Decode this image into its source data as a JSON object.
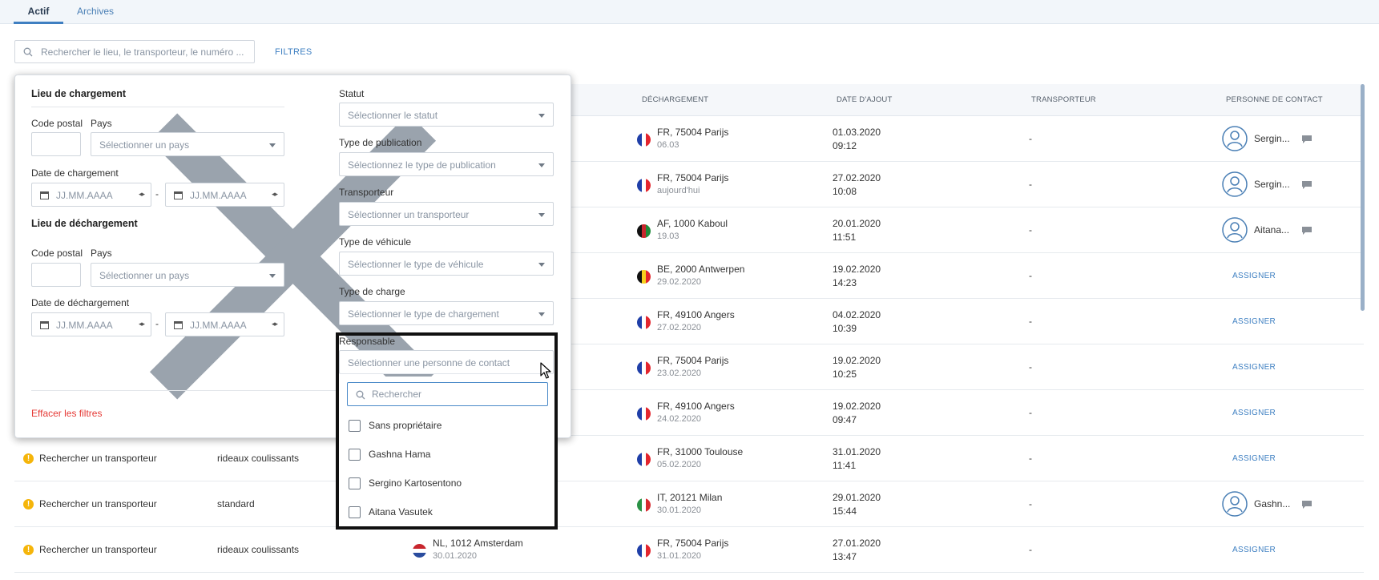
{
  "tabs": {
    "active": "Actif",
    "archives": "Archives"
  },
  "search": {
    "placeholder": "Rechercher le lieu, le transporteur, le numéro ..."
  },
  "filtres_label": "FILTRES",
  "table": {
    "headers": {
      "dechargement": "DÉCHARGEMENT",
      "date_ajout": "DATE D'AJOUT",
      "transporteur": "TRANSPORTEUR",
      "contact": "PERSONNE DE CONTACT"
    },
    "rows": [
      {
        "dest_flag": "FR",
        "dest": "FR, 75004 Parijs",
        "dest_date": "06.03",
        "date": "01.03.2020",
        "time": "09:12",
        "transporteur": "-",
        "contact": "Sergin...",
        "chat": true
      },
      {
        "dest_flag": "FR",
        "dest": "FR, 75004 Parijs",
        "dest_date": "aujourd'hui",
        "date": "27.02.2020",
        "time": "10:08",
        "transporteur": "-",
        "contact": "Sergin...",
        "chat": true
      },
      {
        "dest_flag": "AF",
        "dest": "AF, 1000 Kaboul",
        "dest_date": "19.03",
        "date": "20.01.2020",
        "time": "11:51",
        "transporteur": "-",
        "contact": "Aitana...",
        "chat": true
      },
      {
        "dest_flag": "BE",
        "dest": "BE, 2000 Antwerpen",
        "dest_date": "29.02.2020",
        "date": "19.02.2020",
        "time": "14:23",
        "transporteur": "-",
        "assign": "ASSIGNER"
      },
      {
        "dest_flag": "FR",
        "dest": "FR, 49100 Angers",
        "dest_date": "27.02.2020",
        "date": "04.02.2020",
        "time": "10:39",
        "transporteur": "-",
        "assign": "ASSIGNER"
      },
      {
        "dest_flag": "FR",
        "dest": "FR, 75004 Parijs",
        "dest_date": "23.02.2020",
        "date": "19.02.2020",
        "time": "10:25",
        "transporteur": "-",
        "assign": "ASSIGNER"
      },
      {
        "dest_flag": "FR",
        "dest": "FR, 49100 Angers",
        "dest_date": "24.02.2020",
        "date": "19.02.2020",
        "time": "09:47",
        "transporteur": "-",
        "assign": "ASSIGNER"
      },
      {
        "status": "Rechercher un transporteur",
        "vehicle": "rideaux coulissants",
        "dest_flag": "FR",
        "dest": "FR, 31000 Toulouse",
        "dest_date": "05.02.2020",
        "date": "31.01.2020",
        "time": "11:41",
        "transporteur": "-",
        "assign": "ASSIGNER"
      },
      {
        "status": "Rechercher un transporteur",
        "vehicle": "standard",
        "dest_flag": "IT",
        "dest": "IT, 20121 Milan",
        "dest_date": "30.01.2020",
        "date": "29.01.2020",
        "time": "15:44",
        "transporteur": "-",
        "contact": "Gashn...",
        "chat": true
      },
      {
        "status": "Rechercher un transporteur",
        "vehicle": "rideaux coulissants",
        "origin_flag": "NL",
        "origin": "NL, 1012 Amsterdam",
        "origin_date": "30.01.2020",
        "dest_flag": "FR",
        "dest": "FR, 75004 Parijs",
        "dest_date": "31.01.2020",
        "date": "27.01.2020",
        "time": "13:47",
        "transporteur": "-",
        "assign": "ASSIGNER"
      }
    ]
  },
  "filters": {
    "loading": {
      "title": "Lieu de chargement",
      "code_postal": "Code postal",
      "pays": "Pays",
      "pays_placeholder": "Sélectionner un pays",
      "date_label": "Date de chargement",
      "date_placeholder": "JJ.MM.AAAA"
    },
    "unloading": {
      "title": "Lieu de déchargement",
      "code_postal": "Code postal",
      "pays": "Pays",
      "pays_placeholder": "Sélectionner un pays",
      "date_label": "Date de déchargement",
      "date_placeholder": "JJ.MM.AAAA"
    },
    "statut": {
      "label": "Statut",
      "placeholder": "Sélectionner le statut"
    },
    "publication": {
      "label": "Type de publication",
      "placeholder": "Sélectionnez le type de publication"
    },
    "transporteur": {
      "label": "Transporteur",
      "placeholder": "Sélectionner un transporteur"
    },
    "vehicule": {
      "label": "Type de véhicule",
      "placeholder": "Sélectionner le type de véhicule"
    },
    "charge": {
      "label": "Type de charge",
      "placeholder": "Sélectionner le type de chargement"
    },
    "responsable": {
      "label": "Responsable",
      "placeholder": "Sélectionner une personne de contact",
      "search_placeholder": "Rechercher",
      "options": [
        "Sans propriétaire",
        "Gashna Hama",
        "Sergino Kartosentono",
        "Aitana Vasutek"
      ]
    },
    "clear": "Effacer les filtres"
  },
  "colors": {
    "accent": "#3f80c2",
    "danger": "#e53935",
    "warning": "#f5b50a",
    "highlight": "#111111"
  }
}
